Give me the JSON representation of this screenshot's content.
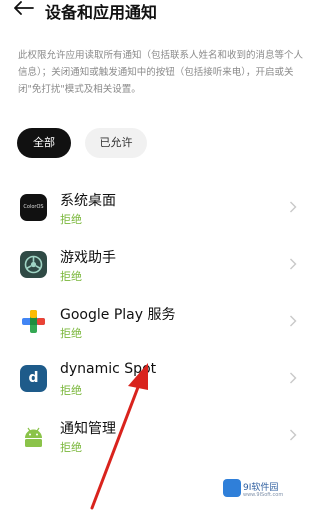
{
  "header": {
    "title": "设备和应用通知",
    "back_icon": "arrow-left-icon"
  },
  "description": "此权限允许应用读取所有通知（包括联系人姓名和收到的消息等个人信息）；关闭通知或触发通知中的按钮（包括接听来电），开启或关闭\"免打扰\"模式及相关设置。",
  "tabs": [
    {
      "label": "全部",
      "selected": true
    },
    {
      "label": "已允许",
      "selected": false
    }
  ],
  "apps": [
    {
      "name": "系统桌面",
      "status": "拒绝",
      "icon": "coloros-icon",
      "icon_text": "ColorOS"
    },
    {
      "name": "游戏助手",
      "status": "拒绝",
      "icon": "game-assistant-icon"
    },
    {
      "name": "Google Play 服务",
      "status": "拒绝",
      "icon": "google-play-services-icon"
    },
    {
      "name": "dynamic Spot",
      "status": "拒绝",
      "icon": "dynamic-spot-icon",
      "icon_text": "d"
    },
    {
      "name": "通知管理",
      "status": "拒绝",
      "icon": "android-icon"
    }
  ],
  "watermark": {
    "text": "9I软件园",
    "subtext": "www.9ISoft.com"
  },
  "colors": {
    "status_green": "#7ab73b",
    "annotation_red": "#d9231d",
    "tab_selected_bg": "#111111"
  }
}
